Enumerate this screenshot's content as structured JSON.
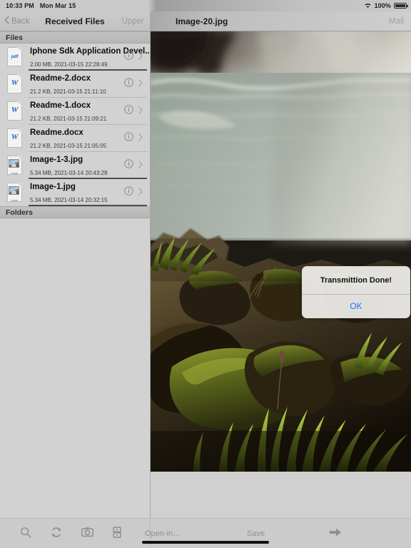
{
  "status_bar": {
    "time": "10:33 PM",
    "date": "Mon Mar 15",
    "battery_percent": "100%",
    "wifi_icon": "wifi-icon",
    "battery_icon": "battery-full-icon"
  },
  "left_panel": {
    "nav": {
      "back_label": "Back",
      "back_icon": "chevron-left-icon",
      "title": "Received Files",
      "upper_label": "Upper"
    },
    "sections": [
      {
        "header": "Files"
      },
      {
        "header": "Folders"
      }
    ],
    "files": [
      {
        "name": "Iphone Sdk Application Devel..",
        "meta": "2.00 MB, 2021-03-15 22:28:49",
        "icon": "pdf-file-icon",
        "icon_label": "pdf",
        "kind": "pdf",
        "progress": true
      },
      {
        "name": "Readme-2.docx",
        "meta": "21.2 KB, 2021-03-15 21:11:10",
        "icon": "word-file-icon",
        "icon_label": "W",
        "kind": "docx",
        "progress": false
      },
      {
        "name": "Readme-1.docx",
        "meta": "21.2 KB, 2021-03-15 21:09:21",
        "icon": "word-file-icon",
        "icon_label": "W",
        "kind": "docx",
        "progress": false
      },
      {
        "name": "Readme.docx",
        "meta": "21.2 KB, 2021-03-15 21:05:05",
        "icon": "word-file-icon",
        "icon_label": "W",
        "kind": "docx",
        "progress": false
      },
      {
        "name": "Image-1-3.jpg",
        "meta": "5.34 MB, 2021-03-14 20:43:28",
        "icon": "image-file-icon",
        "icon_label": "image",
        "kind": "jpg",
        "progress": true
      },
      {
        "name": "Image-1.jpg",
        "meta": "5.34 MB, 2021-03-14 20:32:15",
        "icon": "image-file-icon",
        "icon_label": "image",
        "kind": "jpg",
        "progress": true
      }
    ],
    "row_accessories": {
      "info_icon": "info-circle-icon",
      "disclosure_icon": "chevron-right-icon"
    }
  },
  "right_panel": {
    "nav": {
      "title": "Image-20.jpg",
      "mail_label": "Mail"
    },
    "photo": {
      "alt": "Waterfall mist over green river water with mossy rocks and grass in foreground"
    }
  },
  "alert": {
    "message": "Transmittion Done!",
    "ok_label": "OK"
  },
  "toolbar": {
    "left_icons": [
      {
        "name": "search-icon"
      },
      {
        "name": "refresh-icon"
      },
      {
        "name": "camera-icon"
      },
      {
        "name": "server-icon"
      }
    ],
    "open_in_label": "Open-in...",
    "save_label": "Save",
    "forward_icon": "arrow-right-icon"
  },
  "colors": {
    "accent_blue": "#1a7bf5",
    "doc_blue": "#2b62c9",
    "chrome_gray": "#cbcbcb",
    "panel_gray": "#d2d2d2",
    "text_dark": "#0d0d0d",
    "text_muted": "#8e8e8e"
  }
}
